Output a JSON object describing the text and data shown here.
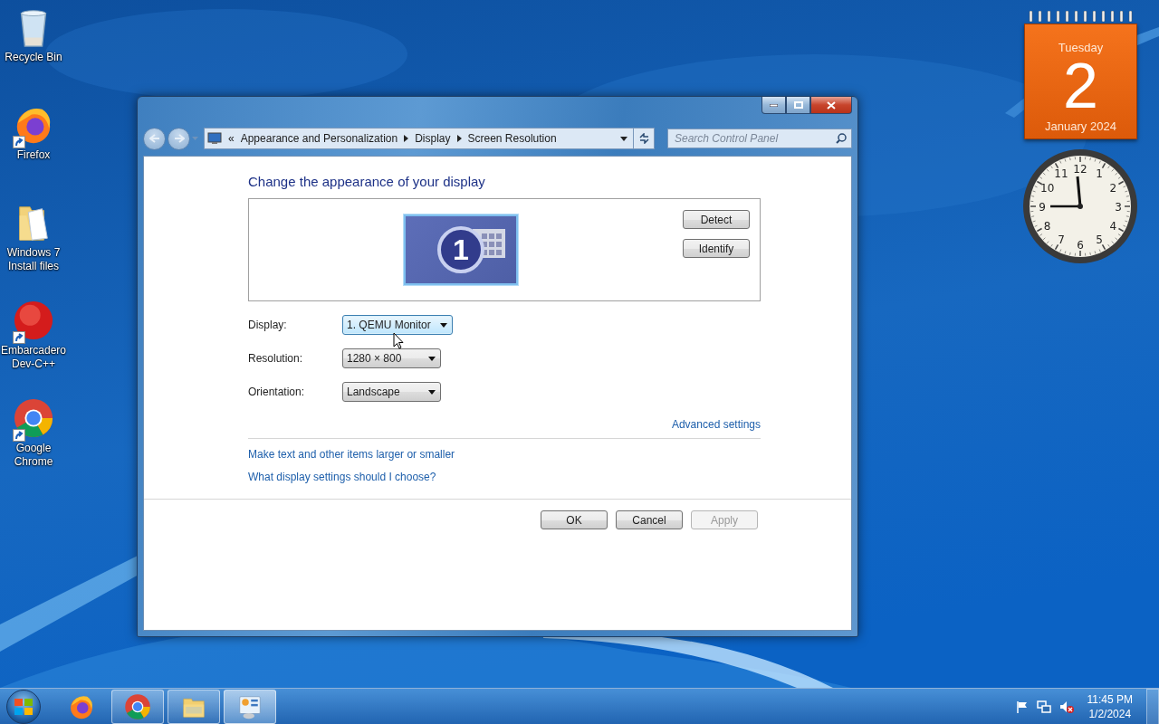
{
  "desktop_icons": [
    {
      "kind": "recycle-bin",
      "label": "Recycle Bin",
      "shortcut": false
    },
    {
      "kind": "firefox",
      "label": "Firefox",
      "shortcut": true
    },
    {
      "kind": "folder",
      "label": "Windows 7 Install files",
      "shortcut": false
    },
    {
      "kind": "devcpp",
      "label": "Embarcadero Dev-C++",
      "shortcut": true
    },
    {
      "kind": "chrome",
      "label": "Google Chrome",
      "shortcut": true
    }
  ],
  "calendar": {
    "weekday": "Tuesday",
    "day": "2",
    "month_year": "January 2024"
  },
  "clock": {
    "numerals": [
      "12",
      "11",
      "1",
      "10",
      "2",
      "9",
      "3",
      "8",
      "4",
      "7",
      "5",
      "6"
    ]
  },
  "window": {
    "breadcrumb": {
      "overflow": "«",
      "items": [
        "Appearance and Personalization",
        "Display",
        "Screen Resolution"
      ]
    },
    "search": {
      "placeholder": "Search Control Panel"
    },
    "heading": "Change the appearance of your display",
    "monitor": {
      "number": "1"
    },
    "side_buttons": [
      "Detect",
      "Identify"
    ],
    "fields": [
      {
        "label": "Display:",
        "value": "1. QEMU Monitor",
        "focused": true
      },
      {
        "label": "Resolution:",
        "value": "1280 × 800",
        "focused": false
      },
      {
        "label": "Orientation:",
        "value": "Landscape",
        "focused": false
      }
    ],
    "advanced_link": "Advanced settings",
    "links": [
      "Make text and other items larger or smaller",
      "What display settings should I choose?"
    ],
    "buttons": [
      {
        "label": "OK",
        "disabled": false
      },
      {
        "label": "Cancel",
        "disabled": false
      },
      {
        "label": "Apply",
        "disabled": true
      }
    ]
  },
  "taskbar": {
    "items": [
      {
        "kind": "firefox",
        "running": false,
        "selected": false
      },
      {
        "kind": "chrome",
        "running": true,
        "selected": false
      },
      {
        "kind": "explorer",
        "running": true,
        "selected": false
      },
      {
        "kind": "control-panel",
        "running": true,
        "selected": true
      }
    ],
    "time": "11:45 PM",
    "date": "1/2/2024"
  }
}
